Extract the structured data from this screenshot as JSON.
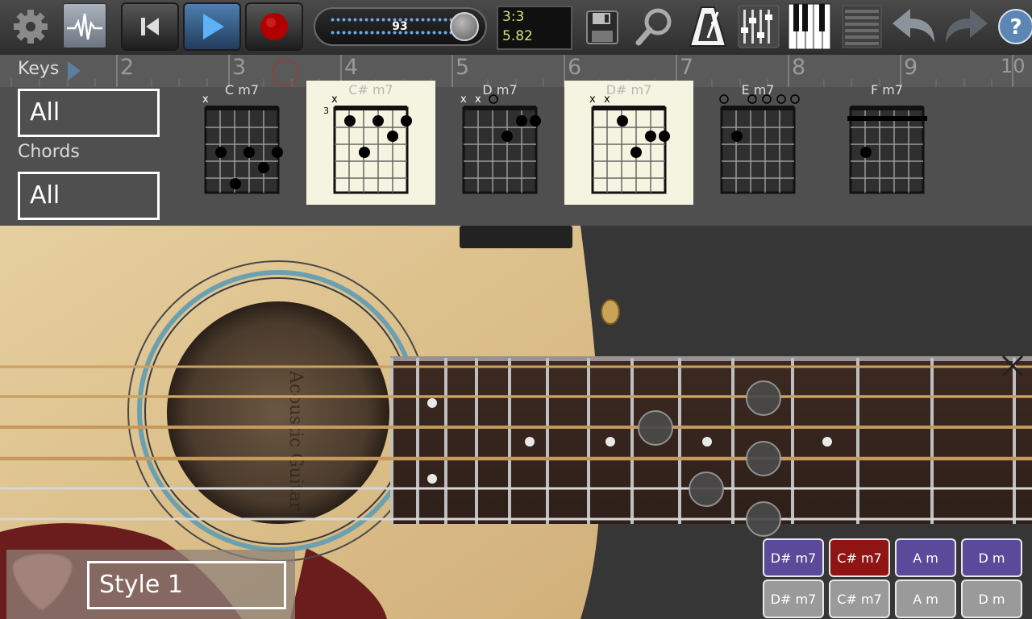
{
  "toolbar": {
    "tempo": "93",
    "time_signature": "3:3",
    "position": "5.82"
  },
  "ruler": {
    "bars": [
      "2",
      "3",
      "4",
      "5",
      "6",
      "7",
      "8",
      "9",
      "10"
    ]
  },
  "filters": {
    "keys_label": "Keys",
    "keys_value": "All",
    "chords_label": "Chords",
    "chords_value": "All"
  },
  "chord_diagrams": [
    {
      "name": "C m7",
      "selected": false
    },
    {
      "name": "C# m7",
      "selected": true,
      "fret_label": "3"
    },
    {
      "name": "D m7",
      "selected": false
    },
    {
      "name": "D# m7",
      "selected": true
    },
    {
      "name": "E m7",
      "selected": false
    },
    {
      "name": "F m7",
      "selected": false
    }
  ],
  "style": {
    "value": "Style 1"
  },
  "chord_buttons": [
    {
      "label": "D# m7",
      "color": "#5b4a9a"
    },
    {
      "label": "C# m7",
      "color": "#8f1414"
    },
    {
      "label": "A m",
      "color": "#5b4a9a"
    },
    {
      "label": "D m",
      "color": "#5b4a9a"
    },
    {
      "label": "D# m7",
      "color": "#9a9a9a"
    },
    {
      "label": "C# m7",
      "color": "#9a9a9a"
    },
    {
      "label": "A m",
      "color": "#9a9a9a"
    },
    {
      "label": "D m",
      "color": "#9a9a9a"
    }
  ],
  "icons": [
    "gear-icon",
    "waveform-icon",
    "skip-back-icon",
    "play-icon",
    "record-icon",
    "save-icon",
    "search-icon",
    "metronome-icon",
    "mixer-icon",
    "piano-icon",
    "list-icon",
    "undo-icon",
    "redo-icon",
    "help-icon",
    "close-icon",
    "guitar-pick-icon"
  ],
  "colors": {
    "selected_chord_card": "#f5f4e1",
    "display_text": "#d7e270",
    "play_button": "#4d7fb0",
    "record": "#b00000"
  }
}
